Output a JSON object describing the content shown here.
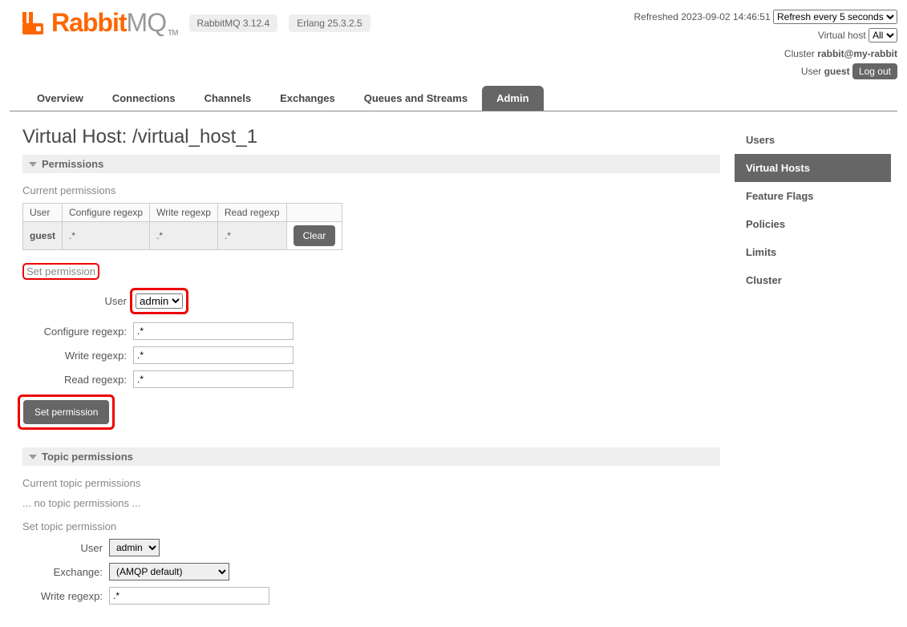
{
  "header": {
    "refreshed_label": "Refreshed",
    "refreshed_at": "2023-09-02 14:46:51",
    "refresh_select": "Refresh every 5 seconds",
    "vhost_label": "Virtual host",
    "vhost_select": "All",
    "cluster_label": "Cluster",
    "cluster_value": "rabbit@my-rabbit",
    "user_label": "User",
    "user_value": "guest",
    "logout": "Log out"
  },
  "logo": {
    "rabbit": "Rabbit",
    "mq": "MQ",
    "tm": "TM"
  },
  "badges": {
    "rmq": "RabbitMQ 3.12.4",
    "erlang": "Erlang 25.3.2.5"
  },
  "nav": {
    "overview": "Overview",
    "connections": "Connections",
    "channels": "Channels",
    "exchanges": "Exchanges",
    "queues": "Queues and Streams",
    "admin": "Admin"
  },
  "page": {
    "title_prefix": "Virtual Host: ",
    "title_value": "/virtual_host_1"
  },
  "sections": {
    "permissions": "Permissions",
    "topic_permissions": "Topic permissions"
  },
  "perm": {
    "current_heading": "Current permissions",
    "th_user": "User",
    "th_conf": "Configure regexp",
    "th_write": "Write regexp",
    "th_read": "Read regexp",
    "row_user": "guest",
    "row_conf": ".*",
    "row_write": ".*",
    "row_read": ".*",
    "clear": "Clear"
  },
  "set_perm": {
    "heading": "Set permission",
    "user_label": "User",
    "user_value": "admin",
    "conf_label": "Configure regexp:",
    "conf_value": ".*",
    "write_label": "Write regexp:",
    "write_value": ".*",
    "read_label": "Read regexp:",
    "read_value": ".*",
    "submit": "Set permission"
  },
  "topic": {
    "current_heading": "Current topic permissions",
    "empty": "... no topic permissions ...",
    "set_heading": "Set topic permission",
    "user_label": "User",
    "user_value": "admin",
    "exchange_label": "Exchange:",
    "exchange_value": "(AMQP default)",
    "write_label": "Write regexp:",
    "write_value": ".*"
  },
  "side": {
    "users": "Users",
    "vhosts": "Virtual Hosts",
    "flags": "Feature Flags",
    "policies": "Policies",
    "limits": "Limits",
    "cluster": "Cluster"
  }
}
